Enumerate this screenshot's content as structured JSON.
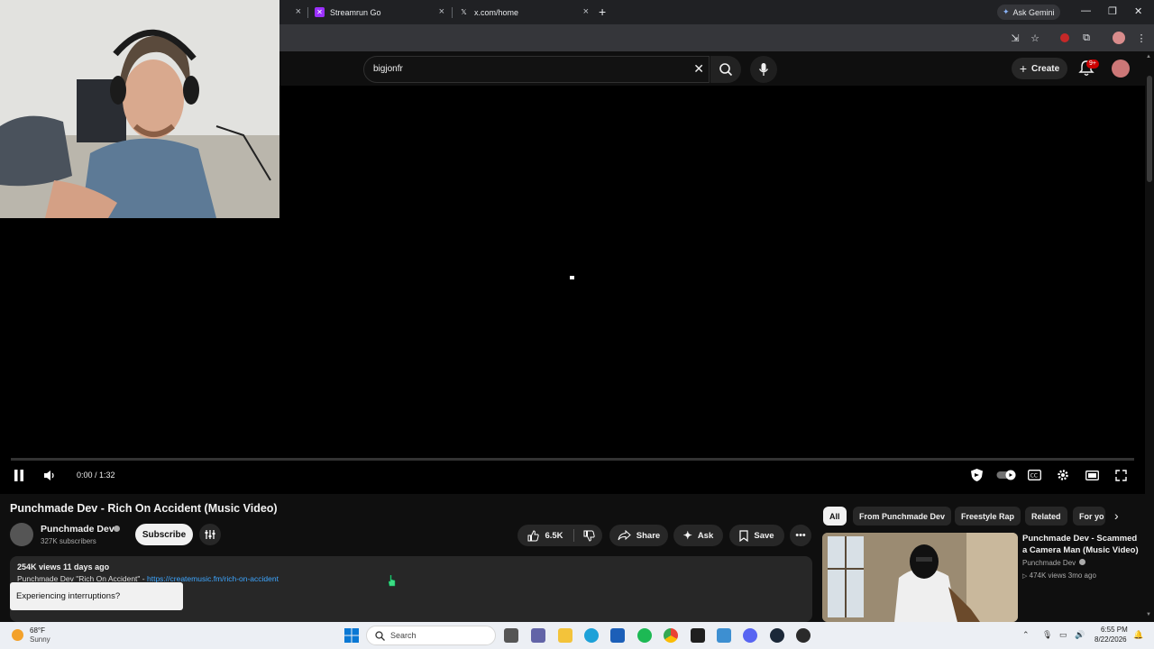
{
  "browser": {
    "tabs": [
      {
        "title": "Streamrun Go",
        "favicon": "streamrun-icon",
        "favicon_color": "#9b30ff"
      },
      {
        "title": "x.com/home",
        "favicon": "x-icon",
        "favicon_color": "#e8eaed"
      }
    ],
    "gemini_label": "Ask Gemini"
  },
  "youtube": {
    "search_query": "bigjonfr",
    "create_label": "Create",
    "notification_badge": "9+"
  },
  "player": {
    "time": "0:00 / 1:32"
  },
  "video": {
    "title": "Punchmade Dev - Rich On Accident (Music Video)",
    "channel": "Punchmade Dev",
    "subscribers": "327K subscribers",
    "subscribe_label": "Subscribe",
    "likes": "6.5K",
    "share_label": "Share",
    "ask_label": "Ask",
    "save_label": "Save",
    "views_date": "254K views  11 days ago",
    "desc_text": "Punchmade Dev \"Rich On Accident\" - ",
    "desc_link": "https://createmusic.fm/rich-on-accident",
    "toast": "Experiencing interruptions?"
  },
  "chips": [
    "All",
    "From Punchmade Dev",
    "Freestyle Rap",
    "Related",
    "For yo"
  ],
  "related": {
    "title": "Punchmade Dev - Scammed a Camera Man (Music Video)",
    "channel": "Punchmade Dev",
    "meta": "474K views  3mo ago"
  },
  "taskbar": {
    "weather_temp": "68°F",
    "weather_cond": "Sunny",
    "search_placeholder": "Search",
    "time": "6:55 PM",
    "date": "8/22/2026"
  },
  "colors": {
    "yt_bg": "#0f0f0f",
    "accent_red": "#cc0000",
    "link_blue": "#3ea6ff"
  }
}
